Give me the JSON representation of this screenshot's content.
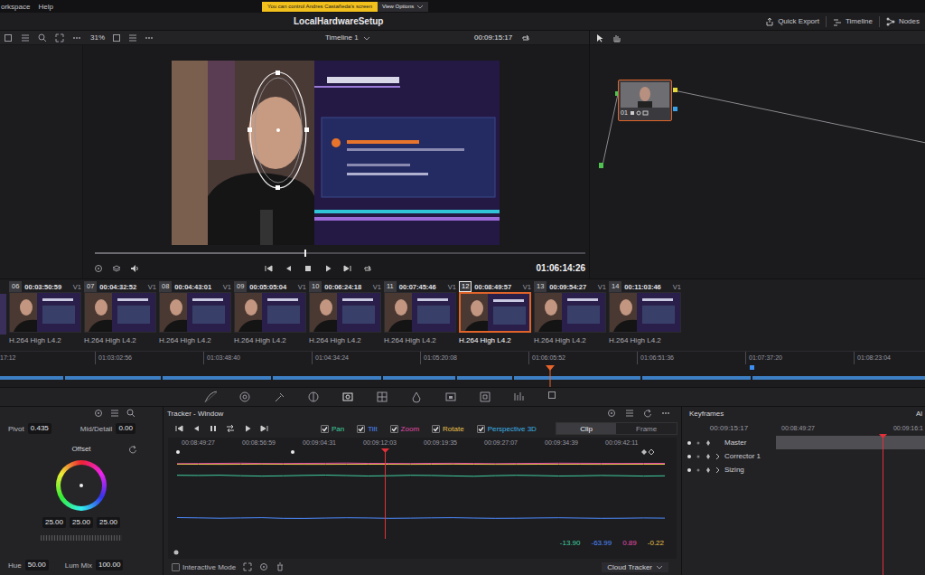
{
  "menu": [
    "orkspace",
    "Help"
  ],
  "share_notice": {
    "text": "You can control Andres Castañeda's screen",
    "button": "View Options"
  },
  "window": {
    "title": "LocalHardwareSetup"
  },
  "header_buttons": [
    "Quick Export",
    "Timeline",
    "Nodes"
  ],
  "viewer": {
    "zoom": "31%",
    "timeline": "Timeline 1",
    "timecode": "00:09:15:17",
    "record_timecode": "01:06:14:26",
    "scrub_level": 0.43
  },
  "node": {
    "label": "01",
    "selected": true
  },
  "clips": [
    {
      "number": "06",
      "timecode": "00:03:50:59",
      "track": "V1",
      "codec": "H.264 High L4.2",
      "selected": false
    },
    {
      "number": "07",
      "timecode": "00:04:32:52",
      "track": "V1",
      "codec": "H.264 High L4.2",
      "selected": false
    },
    {
      "number": "08",
      "timecode": "00:04:43:01",
      "track": "V1",
      "codec": "H.264 High L4.2",
      "selected": false
    },
    {
      "number": "09",
      "timecode": "00:05:05:04",
      "track": "V1",
      "codec": "H.264 High L4.2",
      "selected": false
    },
    {
      "number": "10",
      "timecode": "00:06:24:18",
      "track": "V1",
      "codec": "H.264 High L4.2",
      "selected": false
    },
    {
      "number": "11",
      "timecode": "00:07:45:46",
      "track": "V1",
      "codec": "H.264 High L4.2",
      "selected": false
    },
    {
      "number": "12",
      "timecode": "00:08:49:57",
      "track": "V1",
      "codec": "H.264 High L4.2",
      "selected": true
    },
    {
      "number": "13",
      "timecode": "00:09:54:27",
      "track": "V1",
      "codec": "H.264 High L4.2",
      "selected": false
    },
    {
      "number": "14",
      "timecode": "00:11:03:46",
      "track": "V1",
      "codec": "H.264 High L4.2",
      "selected": false
    }
  ],
  "timeline_ruler": [
    "17:12",
    "01:03:02:56",
    "01:03:48:40",
    "01:04:34:24",
    "01:05:20:08",
    "01:06:05:52",
    "01:06:51:36",
    "01:07:37:20",
    "01:08:23:04"
  ],
  "primaries": {
    "pivot_label": "Pivot",
    "pivot": "0.435",
    "mid_label": "Mid/Detail",
    "mid": "0.00",
    "wheel_title": "Offset",
    "values": [
      "25.00",
      "25.00",
      "25.00"
    ],
    "hue_label": "Hue",
    "hue": "50.00",
    "lum_mix_label": "Lum Mix",
    "lum_mix": "100.00"
  },
  "tracker": {
    "title": "Tracker - Window",
    "options": [
      {
        "label": "Pan",
        "checked": true,
        "color": "#3fcf9f"
      },
      {
        "label": "Tilt",
        "checked": true,
        "color": "#4d8bff"
      },
      {
        "label": "Zoom",
        "checked": true,
        "color": "#e04aa6"
      },
      {
        "label": "Rotate",
        "checked": true,
        "color": "#e8c14a"
      },
      {
        "label": "Perspective 3D",
        "checked": true,
        "color": "#3bb3e6"
      }
    ],
    "modes": [
      {
        "label": "Clip",
        "selected": true
      },
      {
        "label": "Frame",
        "selected": false
      }
    ],
    "ticks": [
      "00:08:49:27",
      "00:08:56:59",
      "00:09:04:31",
      "00:09:12:03",
      "00:09:19:35",
      "00:09:27:07",
      "00:09:34:39",
      "00:09:42:11"
    ],
    "series": [
      {
        "name": "Pan",
        "reading": "-13.90",
        "color": "#3fcf9f",
        "values": [
          -13.2,
          -13.5,
          -13.1,
          -13.8,
          -14.2,
          -13.9,
          -13.4,
          -13.0,
          -13.6,
          -14.1,
          -13.8,
          -13.3,
          -13.5,
          -14.0,
          -14.4,
          -13.7,
          -13.2,
          -13.6,
          -14.1,
          -13.9,
          -13.5,
          -13.8,
          -14.2,
          -13.9
        ]
      },
      {
        "name": "Tilt",
        "reading": "-63.99",
        "color": "#4d8bff",
        "values": [
          -63.4,
          -63.7,
          -64.1,
          -63.8,
          -63.5,
          -64.2,
          -64.4,
          -63.9,
          -63.6,
          -63.8,
          -64.3,
          -64.0,
          -63.7,
          -63.5,
          -63.9,
          -64.2,
          -64.1,
          -63.8,
          -63.6,
          -63.9,
          -64.3,
          -64.1,
          -63.8,
          -63.99
        ]
      },
      {
        "name": "Zoom",
        "reading": "0.89",
        "color": "#e04aa6",
        "values": [
          0.6,
          0.7,
          0.9,
          1.1,
          0.8,
          0.7,
          0.9,
          1.0,
          1.2,
          0.9,
          0.8,
          0.7,
          0.9,
          1.0,
          0.8,
          0.6,
          0.8,
          0.9,
          1.1,
          1.0,
          0.9,
          0.8,
          0.9,
          0.89
        ]
      },
      {
        "name": "Rotate",
        "reading": "-0.22",
        "color": "#e8c14a",
        "values": [
          -0.1,
          -0.2,
          -0.3,
          -0.2,
          -0.1,
          -0.2,
          -0.3,
          -0.25,
          -0.2,
          -0.15,
          -0.2,
          -0.3,
          -0.2,
          -0.1,
          -0.2,
          -0.25,
          -0.3,
          -0.2,
          -0.15,
          -0.2,
          -0.25,
          -0.2,
          -0.2,
          -0.22
        ]
      }
    ],
    "interactive_mode": {
      "label": "Interactive Mode",
      "checked": false
    },
    "dropdown": "Cloud Tracker"
  },
  "keyframes": {
    "title": "Keyframes",
    "mode": "Al",
    "timecode": "00:09:15:17",
    "ticks": [
      "00:08:49:27",
      "00:09:16:1"
    ],
    "tracks": [
      {
        "label": "Master",
        "expandable": false
      },
      {
        "label": "Corrector 1",
        "expandable": true
      },
      {
        "label": "Sizing",
        "expandable": true
      }
    ]
  }
}
